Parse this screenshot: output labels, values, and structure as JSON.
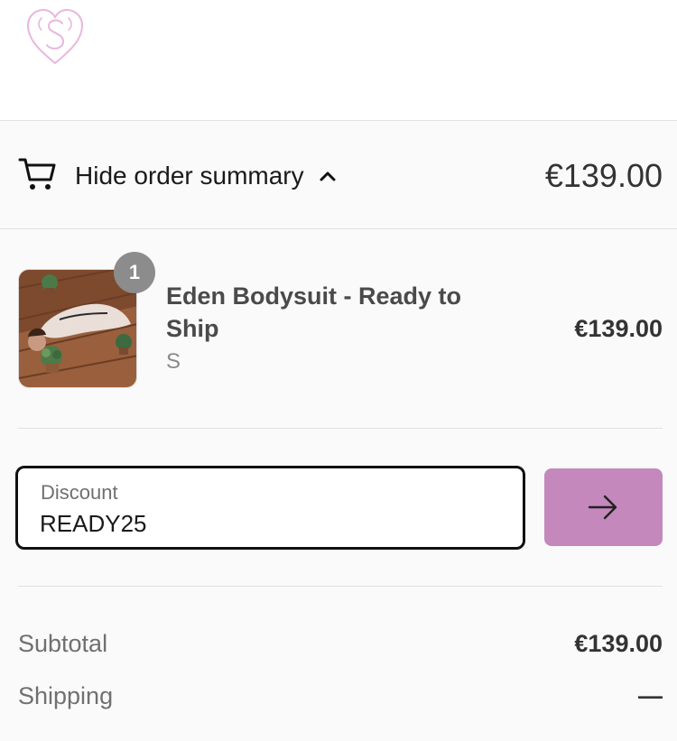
{
  "order_summary": {
    "toggle_label": "Hide order summary",
    "total": "€139.00"
  },
  "line_item": {
    "quantity": "1",
    "name": "Eden Bodysuit - Ready to Ship",
    "variant": "S",
    "price": "€139.00"
  },
  "discount": {
    "label": "Discount",
    "value": "READY25"
  },
  "totals": {
    "subtotal_label": "Subtotal",
    "subtotal_value": "€139.00",
    "shipping_label": "Shipping",
    "shipping_value": "—"
  },
  "colors": {
    "accent": "#c488bc",
    "logo": "#e8b7de",
    "panel_background": "#fafafa"
  },
  "icons": {
    "logo": "heart-monogram-logo",
    "cart": "cart-icon",
    "toggle": "chevron-up-icon",
    "apply": "arrow-right-icon"
  }
}
